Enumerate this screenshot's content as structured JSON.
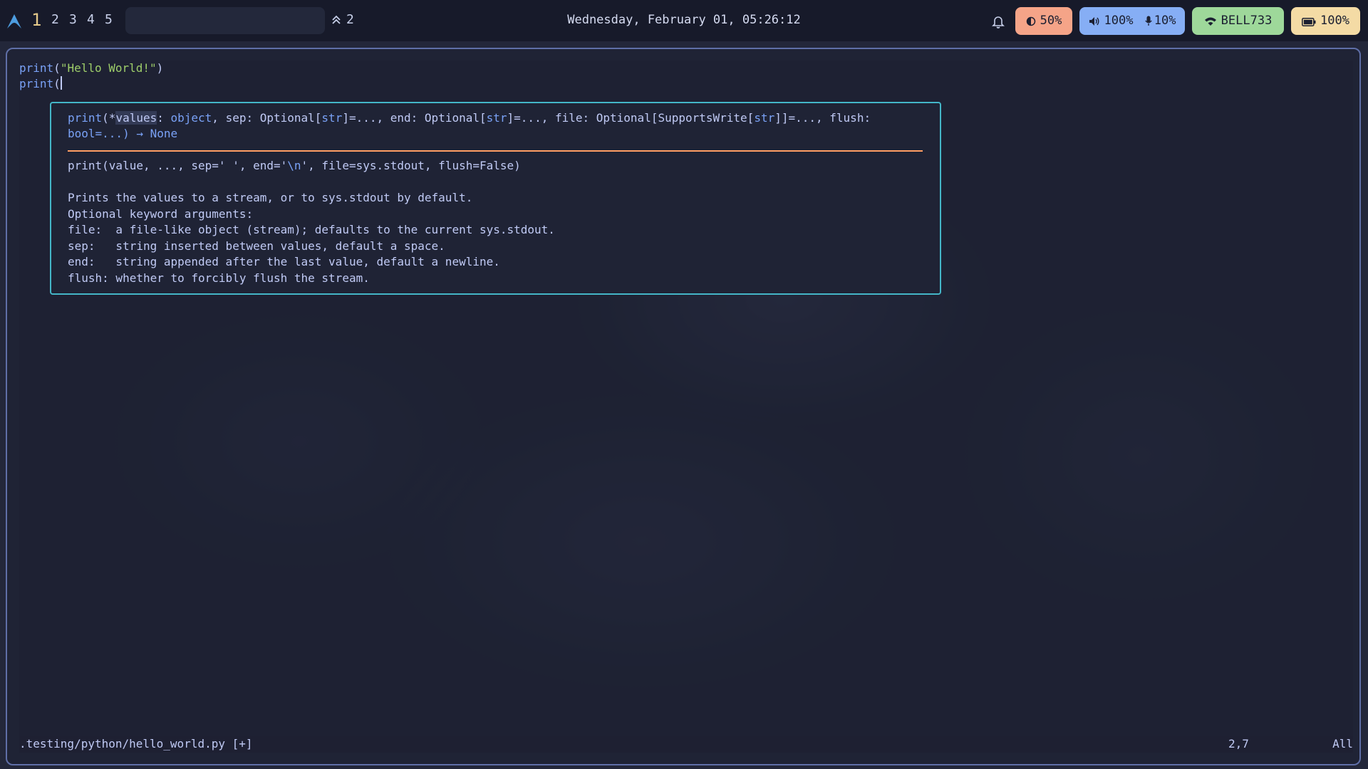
{
  "topbar": {
    "workspaces": [
      "1",
      "2",
      "3",
      "4",
      "5"
    ],
    "active_workspace": "1",
    "updates_count": "2",
    "clock": "Wednesday, February 01, 05:26:12",
    "brightness": "50%",
    "volume": "100%",
    "mic": "10%",
    "wifi_ssid": "BELL733",
    "battery": "100%",
    "icons": {
      "logo": "arch-logo-icon",
      "updates": "double-chevron-up-icon",
      "notifications": "bell-icon",
      "brightness": "brightness-icon",
      "volume": "speaker-icon",
      "mic": "microphone-icon",
      "wifi": "wifi-icon",
      "battery": "battery-icon"
    },
    "colors": {
      "brightness_pill": "#f5a488",
      "audio_pill": "#86aef5",
      "wifi_pill": "#9ed89a",
      "battery_pill": "#f4dba5"
    }
  },
  "editor": {
    "line1_fn": "print",
    "line1_open": "(",
    "line1_str": "\"Hello World!\"",
    "line1_close": ")",
    "line2_fn": "print",
    "line2_open": "("
  },
  "hover": {
    "sig_fn": "print",
    "sig_star": "(*",
    "sig_param": "values",
    "sig_colon": ": ",
    "sig_object": "object",
    "sig_sep": ", sep: Optional[",
    "sig_str1": "str",
    "sig_end": "]=..., end: Optional[",
    "sig_str2": "str",
    "sig_file": "]=..., file: Optional[SupportsWrite[",
    "sig_str3": "str",
    "sig_flush": "]]=..., flush:",
    "sig_line2": "bool=...) → ",
    "sig_none": "None",
    "doc_signature_a": "print(value, ..., sep=' ', end='",
    "doc_signature_esc": "\\n",
    "doc_signature_b": "', file=sys.stdout, flush=False)",
    "doc_lines": [
      "Prints the values to a stream, or to sys.stdout by default.",
      "Optional keyword arguments:",
      "file:  a file-like object (stream); defaults to the current sys.stdout.",
      "sep:   string inserted between values, default a space.",
      "end:   string appended after the last value, default a newline.",
      "flush: whether to forcibly flush the stream."
    ]
  },
  "status": {
    "file": ".testing/python/hello_world.py [+]",
    "position": "2,7",
    "scroll": "All"
  }
}
